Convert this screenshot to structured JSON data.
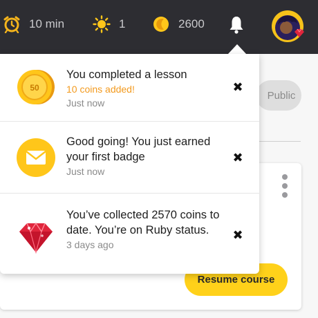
{
  "topbar": {
    "timer": {
      "icon": "alarm-clock-icon",
      "value": "10 min"
    },
    "streak": {
      "icon": "sun-icon",
      "value": "1"
    },
    "coins": {
      "icon": "coin-icon",
      "value": "2600"
    },
    "notifications_icon": "bell-icon",
    "avatar": "user-avatar-ruby-badge"
  },
  "page": {
    "visibility_pill": "Public",
    "resume_button": "Resume course"
  },
  "notifications": [
    {
      "icon": "coin-50-icon",
      "title": "You completed a lesson",
      "subtitle": "10 coins added!",
      "time": "Just now",
      "coin_label": "50"
    },
    {
      "icon": "envelope-icon",
      "title": "Good going! You just earned your first badge",
      "subtitle": "",
      "time": "Just now"
    },
    {
      "icon": "ruby-gem-icon",
      "title": "You’ve collected 2570 coins to date. You’re on Ruby status.",
      "subtitle": "",
      "time": "3 days ago"
    }
  ],
  "colors": {
    "topbar_bg": "#2d2d32",
    "accent_yellow": "#ffd11a",
    "coins_added_orange": "#f39a1e",
    "ruby_red": "#e0253c"
  }
}
